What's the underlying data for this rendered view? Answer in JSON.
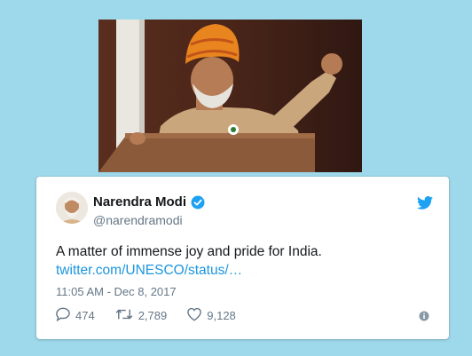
{
  "tweet": {
    "name": "Narendra Modi",
    "handle": "@narendramodi",
    "text": "A matter of immense joy and pride for India.",
    "link": "twitter.com/UNESCO/status/…",
    "timestamp": "11:05 AM - Dec 8, 2017",
    "replies": "474",
    "retweets": "2,789",
    "likes": "9,128"
  },
  "icons": {
    "verified": "verified-badge-icon",
    "bird": "twitter-bird-icon",
    "reply": "reply-icon",
    "retweet": "retweet-icon",
    "like": "heart-icon",
    "info": "info-icon"
  },
  "colors": {
    "page_background": "#9dd9ea",
    "link": "#1b95e0",
    "secondary_text": "#657786",
    "verified": "#1da1f2"
  }
}
